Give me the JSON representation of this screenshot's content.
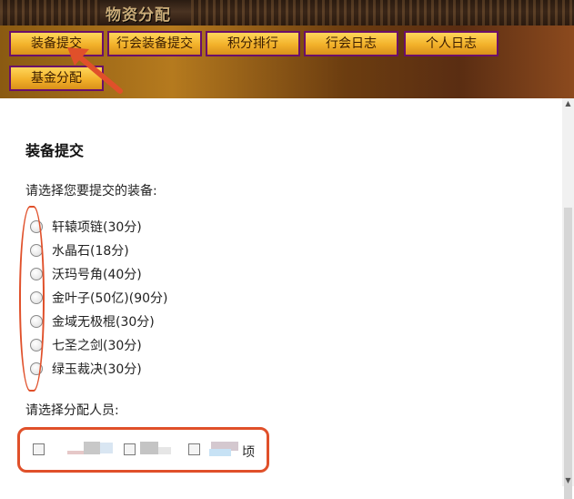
{
  "window": {
    "title": "物资分配"
  },
  "tabs": [
    {
      "label": "装备提交"
    },
    {
      "label": "行会装备提交"
    },
    {
      "label": "积分排行"
    },
    {
      "label": "行会日志"
    },
    {
      "label": "个人日志"
    },
    {
      "label": "基金分配"
    }
  ],
  "form": {
    "heading": "装备提交",
    "equipment_prompt": "请选择您要提交的装备:",
    "equipment": [
      {
        "label": "轩辕项链(30分)"
      },
      {
        "label": "水晶石(18分)"
      },
      {
        "label": "沃玛号角(40分)"
      },
      {
        "label": "金叶子(50亿)(90分)"
      },
      {
        "label": "金域无极棍(30分)"
      },
      {
        "label": "七圣之剑(30分)"
      },
      {
        "label": "绿玉裁决(30分)"
      }
    ],
    "members_prompt": "请选择分配人员:",
    "members": [
      {
        "label": ""
      },
      {
        "label": ""
      },
      {
        "label": "顷"
      }
    ]
  },
  "colors": {
    "annotation": "#e0502a",
    "tab_border": "#6a0f6a",
    "tab_fill": "#f2b12a"
  },
  "icons": {
    "annotation_arrow": "arrow-icon"
  }
}
